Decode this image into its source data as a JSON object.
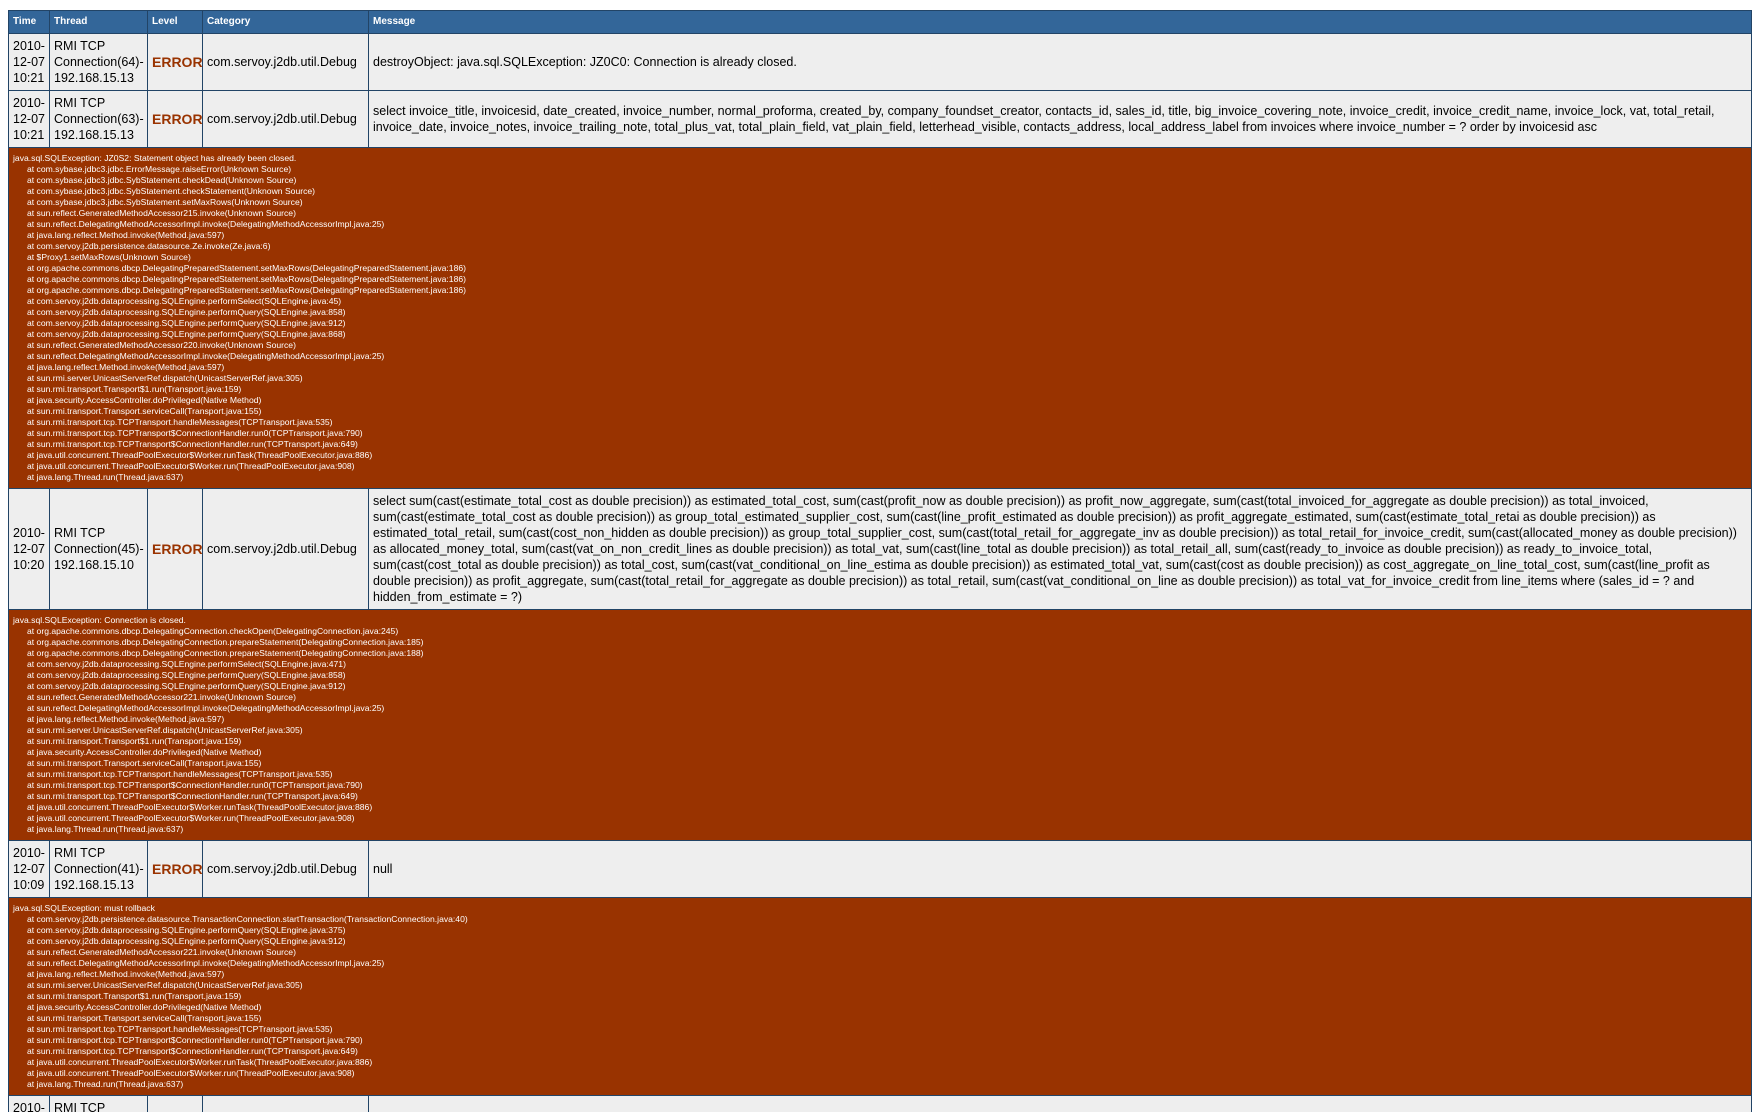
{
  "columns": {
    "time": "Time",
    "thread": "Thread",
    "level": "Level",
    "category": "Category",
    "message": "Message"
  },
  "rows": [
    {
      "time": [
        "2010-",
        "12-07",
        "10:21"
      ],
      "thread": [
        "RMI TCP",
        "Connection(64)-",
        "192.168.15.13"
      ],
      "level": "ERROR",
      "category": "com.servoy.j2db.util.Debug",
      "message": "destroyObject: java.sql.SQLException: JZ0C0: Connection is already closed.",
      "trace": null
    },
    {
      "time": [
        "2010-",
        "12-07",
        "10:21"
      ],
      "thread": [
        "RMI TCP",
        "Connection(63)-",
        "192.168.15.13"
      ],
      "level": "ERROR",
      "category": "com.servoy.j2db.util.Debug",
      "message": "select invoice_title, invoicesid, date_created, invoice_number, normal_proforma, created_by, company_foundset_creator, contacts_id, sales_id, title, big_invoice_covering_note, invoice_credit, invoice_credit_name, invoice_lock, vat, total_retail, invoice_date, invoice_notes, invoice_trailing_note, total_plus_vat, total_plain_field, vat_plain_field, letterhead_visible, contacts_address, local_address_label from invoices where invoice_number = ? order by invoicesid asc",
      "trace": {
        "exception": "java.sql.SQLException: JZ0S2: Statement object has already been closed.",
        "frames": [
          "at com.sybase.jdbc3.jdbc.ErrorMessage.raiseError(Unknown Source)",
          "at com.sybase.jdbc3.jdbc.SybStatement.checkDead(Unknown Source)",
          "at com.sybase.jdbc3.jdbc.SybStatement.checkStatement(Unknown Source)",
          "at com.sybase.jdbc3.jdbc.SybStatement.setMaxRows(Unknown Source)",
          "at sun.reflect.GeneratedMethodAccessor215.invoke(Unknown Source)",
          "at sun.reflect.DelegatingMethodAccessorImpl.invoke(DelegatingMethodAccessorImpl.java:25)",
          "at java.lang.reflect.Method.invoke(Method.java:597)",
          "at com.servoy.j2db.persistence.datasource.Ze.invoke(Ze.java:6)",
          "at $Proxy1.setMaxRows(Unknown Source)",
          "at org.apache.commons.dbcp.DelegatingPreparedStatement.setMaxRows(DelegatingPreparedStatement.java:186)",
          "at org.apache.commons.dbcp.DelegatingPreparedStatement.setMaxRows(DelegatingPreparedStatement.java:186)",
          "at org.apache.commons.dbcp.DelegatingPreparedStatement.setMaxRows(DelegatingPreparedStatement.java:186)",
          "at com.servoy.j2db.dataprocessing.SQLEngine.performSelect(SQLEngine.java:45)",
          "at com.servoy.j2db.dataprocessing.SQLEngine.performQuery(SQLEngine.java:858)",
          "at com.servoy.j2db.dataprocessing.SQLEngine.performQuery(SQLEngine.java:912)",
          "at com.servoy.j2db.dataprocessing.SQLEngine.performQuery(SQLEngine.java:868)",
          "at sun.reflect.GeneratedMethodAccessor220.invoke(Unknown Source)",
          "at sun.reflect.DelegatingMethodAccessorImpl.invoke(DelegatingMethodAccessorImpl.java:25)",
          "at java.lang.reflect.Method.invoke(Method.java:597)",
          "at sun.rmi.server.UnicastServerRef.dispatch(UnicastServerRef.java:305)",
          "at sun.rmi.transport.Transport$1.run(Transport.java:159)",
          "at java.security.AccessController.doPrivileged(Native Method)",
          "at sun.rmi.transport.Transport.serviceCall(Transport.java:155)",
          "at sun.rmi.transport.tcp.TCPTransport.handleMessages(TCPTransport.java:535)",
          "at sun.rmi.transport.tcp.TCPTransport$ConnectionHandler.run0(TCPTransport.java:790)",
          "at sun.rmi.transport.tcp.TCPTransport$ConnectionHandler.run(TCPTransport.java:649)",
          "at java.util.concurrent.ThreadPoolExecutor$Worker.runTask(ThreadPoolExecutor.java:886)",
          "at java.util.concurrent.ThreadPoolExecutor$Worker.run(ThreadPoolExecutor.java:908)",
          "at java.lang.Thread.run(Thread.java:637)"
        ]
      }
    },
    {
      "time": [
        "2010-",
        "12-07",
        "10:20"
      ],
      "thread": [
        "RMI TCP",
        "Connection(45)-",
        "192.168.15.10"
      ],
      "level": "ERROR",
      "category": "com.servoy.j2db.util.Debug",
      "message": "select sum(cast(estimate_total_cost as double precision)) as estimated_total_cost, sum(cast(profit_now as double precision)) as profit_now_aggregate, sum(cast(total_invoiced_for_aggregate as double precision)) as total_invoiced, sum(cast(estimate_total_cost as double precision)) as group_total_estimated_supplier_cost, sum(cast(line_profit_estimated as double precision)) as profit_aggregate_estimated, sum(cast(estimate_total_retai as double precision)) as estimated_total_retail, sum(cast(cost_non_hidden as double precision)) as group_total_supplier_cost, sum(cast(total_retail_for_aggregate_inv as double precision)) as total_retail_for_invoice_credit, sum(cast(allocated_money as double precision)) as allocated_money_total, sum(cast(vat_on_non_credit_lines as double precision)) as total_vat, sum(cast(line_total as double precision)) as total_retail_all, sum(cast(ready_to_invoice as double precision)) as ready_to_invoice_total, sum(cast(cost_total as double precision)) as total_cost, sum(cast(vat_conditional_on_line_estima as double precision)) as estimated_total_vat, sum(cast(cost as double precision)) as cost_aggregate_on_line_total_cost, sum(cast(line_profit as double precision)) as profit_aggregate, sum(cast(total_retail_for_aggregate as double precision)) as total_retail, sum(cast(vat_conditional_on_line as double precision)) as total_vat_for_invoice_credit from line_items where (sales_id = ? and hidden_from_estimate = ?)",
      "trace": {
        "exception": "java.sql.SQLException: Connection is closed.",
        "frames": [
          "at org.apache.commons.dbcp.DelegatingConnection.checkOpen(DelegatingConnection.java:245)",
          "at org.apache.commons.dbcp.DelegatingConnection.prepareStatement(DelegatingConnection.java:185)",
          "at org.apache.commons.dbcp.DelegatingConnection.prepareStatement(DelegatingConnection.java:188)",
          "at com.servoy.j2db.dataprocessing.SQLEngine.performSelect(SQLEngine.java:471)",
          "at com.servoy.j2db.dataprocessing.SQLEngine.performQuery(SQLEngine.java:858)",
          "at com.servoy.j2db.dataprocessing.SQLEngine.performQuery(SQLEngine.java:912)",
          "at sun.reflect.GeneratedMethodAccessor221.invoke(Unknown Source)",
          "at sun.reflect.DelegatingMethodAccessorImpl.invoke(DelegatingMethodAccessorImpl.java:25)",
          "at java.lang.reflect.Method.invoke(Method.java:597)",
          "at sun.rmi.server.UnicastServerRef.dispatch(UnicastServerRef.java:305)",
          "at sun.rmi.transport.Transport$1.run(Transport.java:159)",
          "at java.security.AccessController.doPrivileged(Native Method)",
          "at sun.rmi.transport.Transport.serviceCall(Transport.java:155)",
          "at sun.rmi.transport.tcp.TCPTransport.handleMessages(TCPTransport.java:535)",
          "at sun.rmi.transport.tcp.TCPTransport$ConnectionHandler.run0(TCPTransport.java:790)",
          "at sun.rmi.transport.tcp.TCPTransport$ConnectionHandler.run(TCPTransport.java:649)",
          "at java.util.concurrent.ThreadPoolExecutor$Worker.runTask(ThreadPoolExecutor.java:886)",
          "at java.util.concurrent.ThreadPoolExecutor$Worker.run(ThreadPoolExecutor.java:908)",
          "at java.lang.Thread.run(Thread.java:637)"
        ]
      }
    },
    {
      "time": [
        "2010-",
        "12-07",
        "10:09"
      ],
      "thread": [
        "RMI TCP",
        "Connection(41)-",
        "192.168.15.13"
      ],
      "level": "ERROR",
      "category": "com.servoy.j2db.util.Debug",
      "message": "null",
      "trace": {
        "exception": "java.sql.SQLException: must rollback",
        "frames": [
          "at com.servoy.j2db.persistence.datasource.TransactionConnection.startTransaction(TransactionConnection.java:40)",
          "at com.servoy.j2db.dataprocessing.SQLEngine.performQuery(SQLEngine.java:375)",
          "at com.servoy.j2db.dataprocessing.SQLEngine.performQuery(SQLEngine.java:912)",
          "at sun.reflect.GeneratedMethodAccessor221.invoke(Unknown Source)",
          "at sun.reflect.DelegatingMethodAccessorImpl.invoke(DelegatingMethodAccessorImpl.java:25)",
          "at java.lang.reflect.Method.invoke(Method.java:597)",
          "at sun.rmi.server.UnicastServerRef.dispatch(UnicastServerRef.java:305)",
          "at sun.rmi.transport.Transport$1.run(Transport.java:159)",
          "at java.security.AccessController.doPrivileged(Native Method)",
          "at sun.rmi.transport.Transport.serviceCall(Transport.java:155)",
          "at sun.rmi.transport.tcp.TCPTransport.handleMessages(TCPTransport.java:535)",
          "at sun.rmi.transport.tcp.TCPTransport$ConnectionHandler.run0(TCPTransport.java:790)",
          "at sun.rmi.transport.tcp.TCPTransport$ConnectionHandler.run(TCPTransport.java:649)",
          "at java.util.concurrent.ThreadPoolExecutor$Worker.runTask(ThreadPoolExecutor.java:886)",
          "at java.util.concurrent.ThreadPoolExecutor$Worker.run(ThreadPoolExecutor.java:908)",
          "at java.lang.Thread.run(Thread.java:637)"
        ]
      }
    },
    {
      "time": [
        "2010-"
      ],
      "thread": [
        "RMI TCP"
      ],
      "level": "",
      "category": "",
      "message": "",
      "trace": null
    }
  ]
}
